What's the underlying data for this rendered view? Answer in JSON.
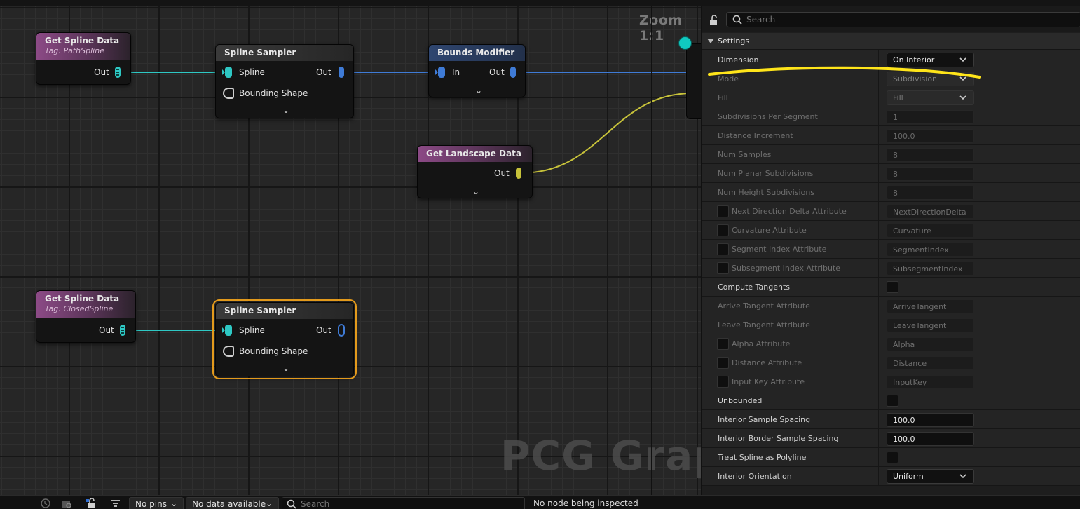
{
  "graph": {
    "zoom_label": "Zoom 1:1",
    "watermark": "PCG Graph",
    "nodes": {
      "get_spline_1": {
        "title": "Get Spline Data",
        "tag": "Tag: PathSpline",
        "out": "Out"
      },
      "spline_sampler_1": {
        "title": "Spline Sampler",
        "in_spline": "Spline",
        "in_shape": "Bounding Shape",
        "out": "Out"
      },
      "bounds_modifier": {
        "title": "Bounds Modifier",
        "in": "In",
        "out": "Out"
      },
      "get_landscape": {
        "title": "Get Landscape Data",
        "out": "Out"
      },
      "get_spline_2": {
        "title": "Get Spline Data",
        "tag": "Tag: ClosedSpline",
        "out": "Out"
      },
      "spline_sampler_2": {
        "title": "Spline Sampler",
        "in_spline": "Spline",
        "in_shape": "Bounding Shape",
        "out": "Out"
      }
    },
    "colors": {
      "spline_wire": "#2ec8c4",
      "bounds_wire": "#3f7bd6",
      "landscape_wire": "#c7c23a",
      "selection": "#e39a1c"
    }
  },
  "panel": {
    "search_placeholder": "Search",
    "section_title": "Settings",
    "rows": [
      {
        "label": "Dimension",
        "kind": "dropdown",
        "value": "On Interior",
        "dim": false
      },
      {
        "label": "Mode",
        "kind": "dropdown",
        "value": "Subdivision",
        "dim": true
      },
      {
        "label": "Fill",
        "kind": "dropdown",
        "value": "Fill",
        "dim": true
      },
      {
        "label": "Subdivisions Per Segment",
        "kind": "input",
        "value": "1",
        "dim": true
      },
      {
        "label": "Distance Increment",
        "kind": "input",
        "value": "100.0",
        "dim": true
      },
      {
        "label": "Num Samples",
        "kind": "input",
        "value": "8",
        "dim": true
      },
      {
        "label": "Num Planar Subdivisions",
        "kind": "input",
        "value": "8",
        "dim": true
      },
      {
        "label": "Num Height Subdivisions",
        "kind": "input",
        "value": "8",
        "dim": true
      },
      {
        "label": "Next Direction Delta Attribute",
        "kind": "cbtext",
        "value": "NextDirectionDelta",
        "dim": true
      },
      {
        "label": "Curvature Attribute",
        "kind": "cbtext",
        "value": "Curvature",
        "dim": true
      },
      {
        "label": "Segment Index Attribute",
        "kind": "cbtext",
        "value": "SegmentIndex",
        "dim": true
      },
      {
        "label": "Subsegment Index Attribute",
        "kind": "cbtext",
        "value": "SubsegmentIndex",
        "dim": true
      },
      {
        "label": "Compute Tangents",
        "kind": "checkbox",
        "value": "",
        "dim": false
      },
      {
        "label": "Arrive Tangent Attribute",
        "kind": "text",
        "value": "ArriveTangent",
        "dim": true
      },
      {
        "label": "Leave Tangent Attribute",
        "kind": "text",
        "value": "LeaveTangent",
        "dim": true
      },
      {
        "label": "Alpha Attribute",
        "kind": "cbtext",
        "value": "Alpha",
        "dim": true
      },
      {
        "label": "Distance Attribute",
        "kind": "cbtext",
        "value": "Distance",
        "dim": true
      },
      {
        "label": "Input Key Attribute",
        "kind": "cbtext",
        "value": "InputKey",
        "dim": true
      },
      {
        "label": "Unbounded",
        "kind": "checkbox",
        "value": "",
        "dim": false
      },
      {
        "label": "Interior Sample Spacing",
        "kind": "input",
        "value": "100.0",
        "dim": false
      },
      {
        "label": "Interior Border Sample Spacing",
        "kind": "input",
        "value": "100.0",
        "dim": false
      },
      {
        "label": "Treat Spline as Polyline",
        "kind": "checkbox",
        "value": "",
        "dim": false
      },
      {
        "label": "Interior Orientation",
        "kind": "dropdown",
        "value": "Uniform",
        "dim": false
      }
    ]
  },
  "bottombar": {
    "pins_label": "No pins",
    "data_label": "No data available",
    "search_placeholder": "Search",
    "status": "No node being inspected"
  }
}
